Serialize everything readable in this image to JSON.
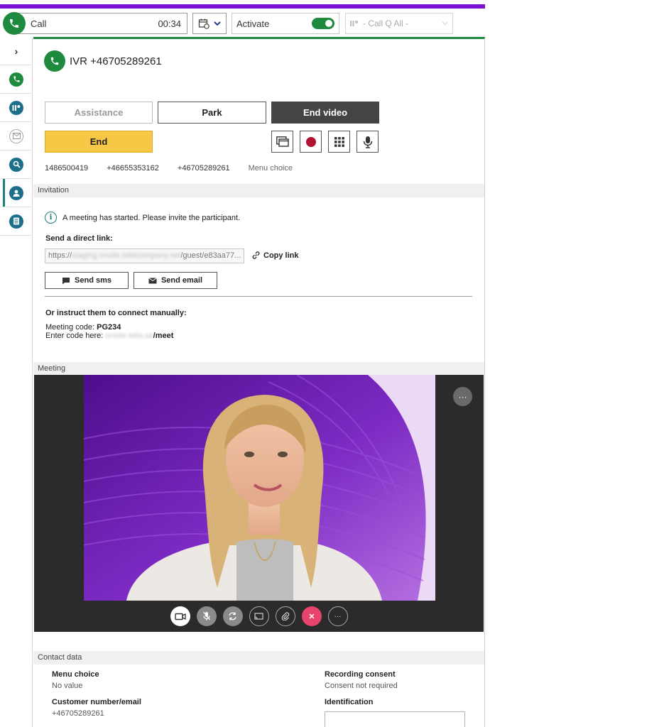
{
  "toolbar": {
    "call_label": "Call",
    "call_timer": "00:34",
    "activate_label": "Activate",
    "activate_on": true,
    "queue_placeholder": "- Call Q All -",
    "accent_color": "#7a12d4",
    "brand_green": "#1d8a3e"
  },
  "rail": {
    "items": [
      "expand",
      "phone",
      "queue",
      "email",
      "search",
      "contacts",
      "notes"
    ],
    "active": "contacts",
    "expand_glyph": "›"
  },
  "call": {
    "caller": "IVR +46705289261",
    "buttons": {
      "assistance": "Assistance",
      "park": "Park",
      "end_video": "End video",
      "end": "End"
    },
    "numbers": [
      "1486500419",
      "+46655353162",
      "+46705289261"
    ],
    "numbers_note": "Menu choice"
  },
  "invitation": {
    "heading": "Invitation",
    "info": "A meeting has started. Please invite the participant.",
    "direct_link_label": "Send a direct link:",
    "link_prefix": "https://",
    "link_blurred": "staging.onsite.teliacompany.net",
    "link_suffix": "/guest/e83aa77...",
    "copy_link": "Copy link",
    "send_sms": "Send sms",
    "send_email": "Send email",
    "manual_label": "Or instruct them to connect manually:",
    "meeting_code_label": "Meeting code: ",
    "meeting_code": "PG234",
    "enter_code_label": "Enter code here: ",
    "enter_code_blurred": "onsite.telia.se",
    "enter_code_suffix": "/meet"
  },
  "meeting": {
    "heading": "Meeting",
    "more": "···",
    "controls": [
      "camera",
      "mute-mic",
      "switch-camera",
      "screen-share",
      "attachment",
      "end-call",
      "more"
    ],
    "controls_more": "···"
  },
  "contact_data": {
    "heading": "Contact data",
    "menu_choice_label": "Menu choice",
    "menu_choice_value": "No value",
    "recording_label": "Recording consent",
    "recording_value": "Consent not required",
    "customer_label": "Customer number/email",
    "customer_value": "+46705289261",
    "identification_label": "Identification",
    "identification_value": ""
  }
}
